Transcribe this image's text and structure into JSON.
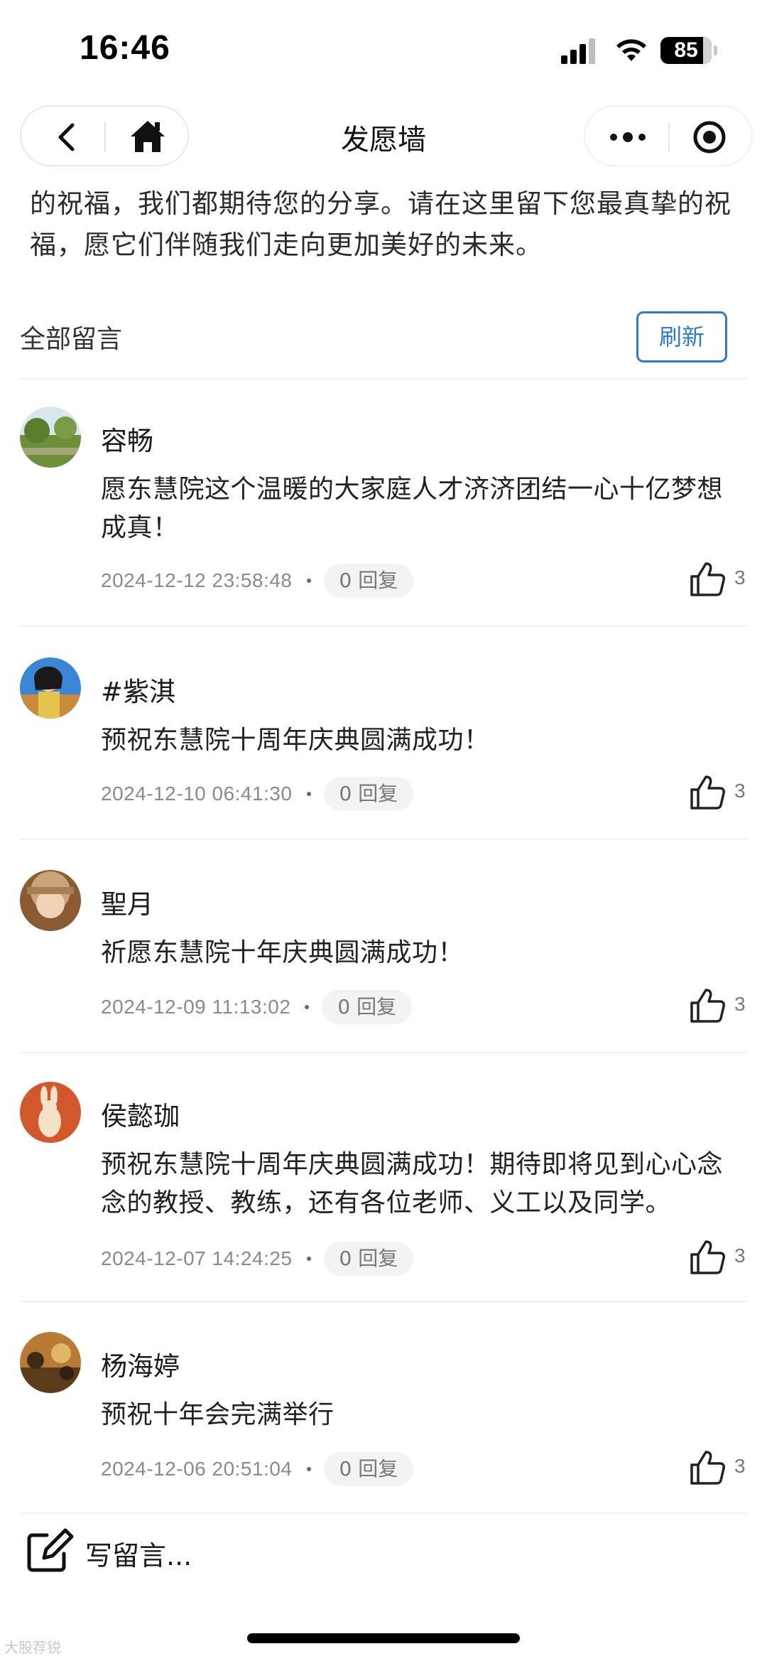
{
  "status_bar": {
    "time": "16:46",
    "battery": "85"
  },
  "nav": {
    "title": "发愿墙"
  },
  "intro": {
    "text": "的祝福，我们都期待您的分享。请在这里留下您最真挚的祝福，愿它们伴随我们走向更加美好的未来。"
  },
  "section": {
    "title": "全部留言",
    "refresh_label": "刷新"
  },
  "comments": [
    {
      "name": "容畅",
      "message": "愿东慧院这个温暖的大家庭人才济济团结一心十亿梦想成真！",
      "time": "2024-12-12 23:58:48",
      "replies": "0 回复",
      "likes": "3"
    },
    {
      "name": "#紫淇",
      "message": "预祝东慧院十周年庆典圆满成功！",
      "time": "2024-12-10 06:41:30",
      "replies": "0 回复",
      "likes": "3"
    },
    {
      "name": "聖月",
      "message": "祈愿东慧院十年庆典圆满成功！",
      "time": "2024-12-09 11:13:02",
      "replies": "0 回复",
      "likes": "3"
    },
    {
      "name": "侯懿珈",
      "message": "预祝东慧院十周年庆典圆满成功！期待即将见到心心念念的教授、教练，还有各位老师、义工以及同学。",
      "time": "2024-12-07 14:24:25",
      "replies": "0 回复",
      "likes": "3"
    },
    {
      "name": "杨海婷",
      "message": "预祝十年会完满举行",
      "time": "2024-12-06 20:51:04",
      "replies": "0 回复",
      "likes": "3"
    }
  ],
  "write": {
    "label": "写留言..."
  },
  "watermark": {
    "text": "大股荐锐"
  },
  "colors": {
    "accent": "#2d7ad6",
    "text": "#1a1a1a",
    "muted": "#8a8a8a",
    "divider": "#f0f0f0"
  }
}
